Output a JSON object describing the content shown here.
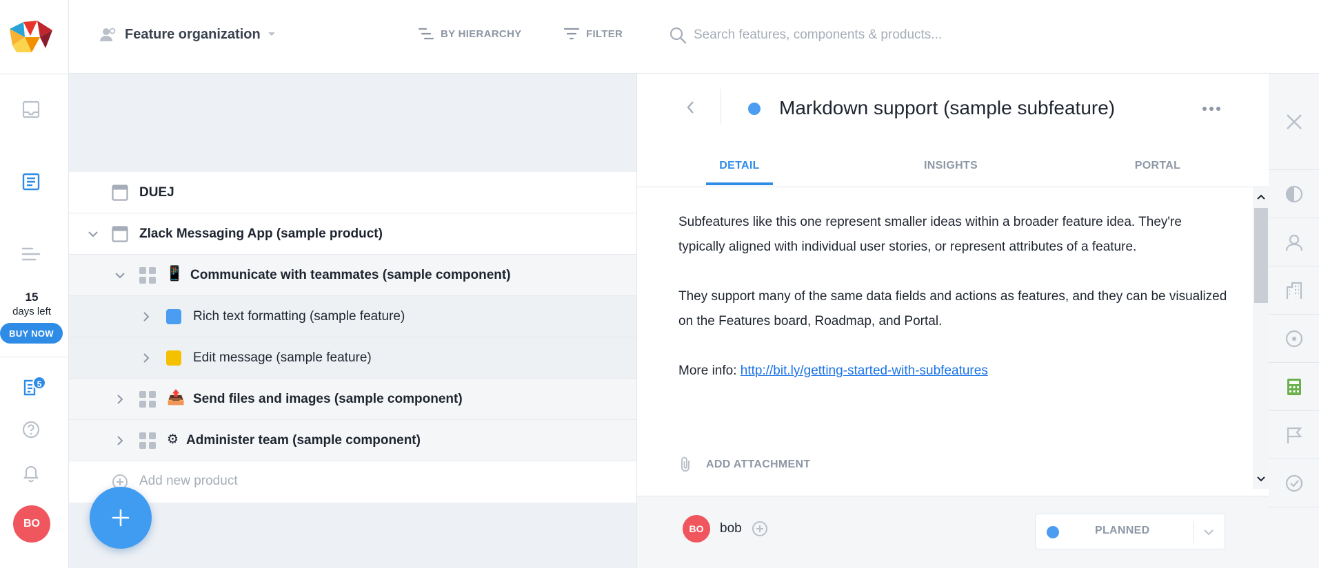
{
  "topbar": {
    "board_name": "Feature organization",
    "hierarchy_label": "BY HIERARCHY",
    "filter_label": "FILTER",
    "search_placeholder": "Search features, components & products..."
  },
  "rail": {
    "trial_days": "15",
    "trial_text": "days left",
    "buy_label": "BUY NOW",
    "notification_count": "5",
    "user_initials": "BO"
  },
  "tree": {
    "rows": [
      {
        "label": "DUEJ"
      },
      {
        "label": "Zlack Messaging App (sample product)"
      },
      {
        "label": "Communicate with teammates (sample component)",
        "emoji": "📱"
      },
      {
        "label": "Rich text formatting (sample feature)",
        "color": "#4a9df0"
      },
      {
        "label": "Edit message (sample feature)",
        "color": "#f5c000"
      },
      {
        "label": "Send files and images (sample component)",
        "emoji": "📤"
      },
      {
        "label": "Administer team (sample component)",
        "emoji": "⚙"
      }
    ],
    "add_product_label": "Add new product"
  },
  "detail": {
    "title": "Markdown support (sample subfeature)",
    "status_color": "#4a9df0",
    "tabs": [
      "DETAIL",
      "INSIGHTS",
      "PORTAL"
    ],
    "active_tab": "DETAIL",
    "paragraphs": [
      "Subfeatures like this one represent smaller ideas within a broader feature idea. They're typically aligned with individual user stories, or represent attributes of a feature.",
      "They support many of the same data fields and actions as features, and they can be visualized on the Features board, Roadmap, and Portal."
    ],
    "more_info_prefix": "More info: ",
    "more_info_link": "http://bit.ly/getting-started-with-subfeatures",
    "attachment_label": "ADD ATTACHMENT",
    "owner_initials": "BO",
    "owner_name": "bob",
    "status_label": "PLANNED"
  },
  "icons": {
    "rail": [
      "inbox-icon",
      "document-list-icon",
      "roadmap-icon",
      "megaphone-icon",
      "release-notes-icon",
      "help-icon",
      "bell-icon"
    ],
    "right_rail": [
      "close-icon",
      "pie-chart-icon",
      "person-icon",
      "building-icon",
      "target-icon",
      "calculator-icon",
      "flag-icon",
      "check-circle-icon"
    ]
  },
  "colors": {
    "accent": "#2f8ce6",
    "avatar": "#f0565e",
    "calculator_active": "#6ab04c"
  }
}
